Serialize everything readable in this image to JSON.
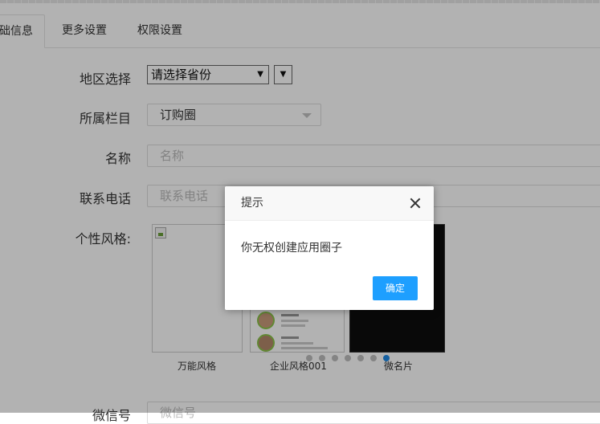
{
  "tabs": [
    {
      "label": "础信息",
      "active": true
    },
    {
      "label": "更多设置",
      "active": false
    },
    {
      "label": "权限设置",
      "active": false
    }
  ],
  "form": {
    "region_label": "地区选择",
    "region_value": "请选择省份",
    "column_label": "所属栏目",
    "column_value": "订购圈",
    "name_label": "名称",
    "name_placeholder": "名称",
    "phone_label": "联系电话",
    "phone_placeholder": "联系电话",
    "style_label": "个性风格:",
    "wechat_label": "微信号",
    "wechat_placeholder": "微信号"
  },
  "styles": [
    {
      "caption": "万能风格"
    },
    {
      "caption": "企业风格001"
    },
    {
      "caption": "微名片"
    }
  ],
  "carousel": {
    "count": 7,
    "active_index": 6,
    "active_color": "#1e88e5"
  },
  "dialog": {
    "title": "提示",
    "message": "你无权创建应用圈子",
    "confirm_label": "确定",
    "button_color": "#1e9fff"
  },
  "icons": {
    "close": "close-icon",
    "dropdown": "caret-down-icon"
  }
}
